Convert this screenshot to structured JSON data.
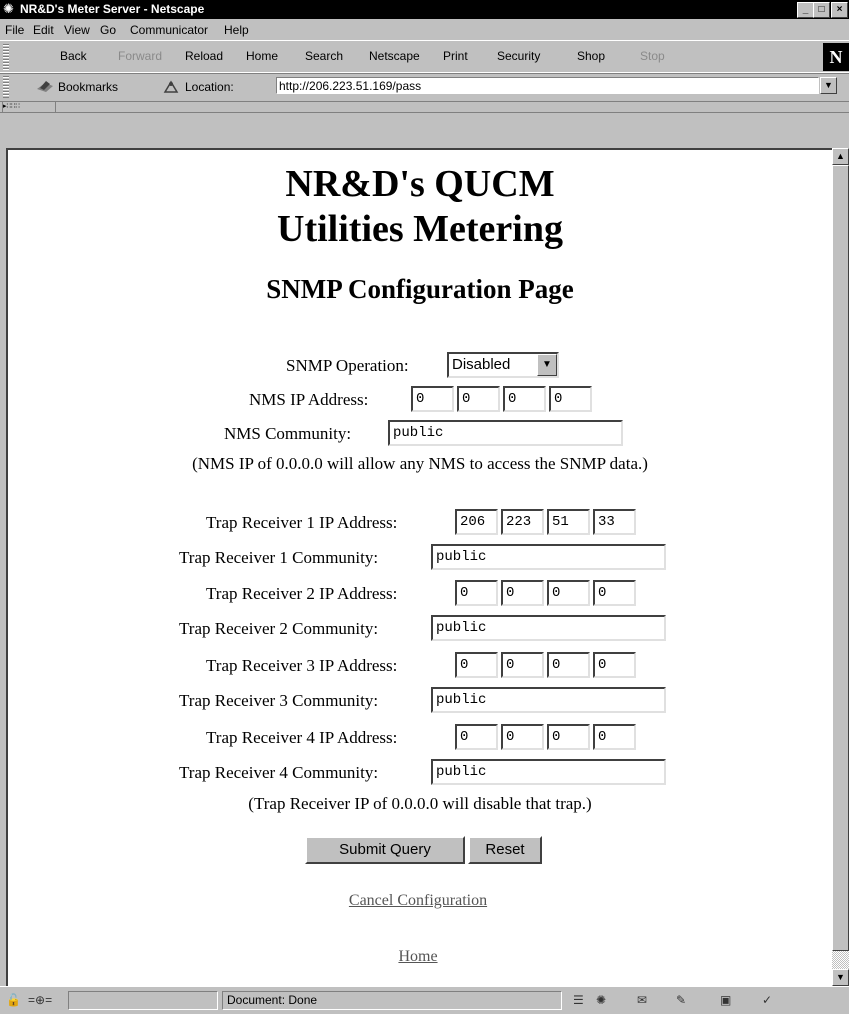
{
  "window": {
    "title": "NR&D's Meter Server - Netscape"
  },
  "menu": [
    "File",
    "Edit",
    "View",
    "Go",
    "Communicator",
    "Help"
  ],
  "toolbar": {
    "back": "Back",
    "forward": "Forward",
    "reload": "Reload",
    "home": "Home",
    "search": "Search",
    "netscape": "Netscape",
    "print": "Print",
    "security": "Security",
    "shop": "Shop",
    "stop": "Stop"
  },
  "location": {
    "bookmarks": "Bookmarks",
    "label": "Location:",
    "url": "http://206.223.51.169/pass"
  },
  "page": {
    "title_line1": "NR&D's QUCM",
    "title_line2": "Utilities Metering",
    "subtitle": "SNMP Configuration Page",
    "snmp_operation_label": "SNMP Operation:",
    "snmp_operation_value": "Disabled",
    "nms_ip_label": "NMS IP Address:",
    "nms_ip": [
      "0",
      "0",
      "0",
      "0"
    ],
    "nms_community_label": "NMS Community:",
    "nms_community": "public",
    "nms_note": "(NMS IP of 0.0.0.0 will allow any NMS to access the SNMP data.)",
    "traps": [
      {
        "ip_label": "Trap Receiver 1 IP Address:",
        "ip": [
          "206",
          "223",
          "51",
          "33"
        ],
        "community_label": "Trap Receiver 1 Community:",
        "community": "public"
      },
      {
        "ip_label": "Trap Receiver 2 IP Address:",
        "ip": [
          "0",
          "0",
          "0",
          "0"
        ],
        "community_label": "Trap Receiver 2 Community:",
        "community": "public"
      },
      {
        "ip_label": "Trap Receiver 3 IP Address:",
        "ip": [
          "0",
          "0",
          "0",
          "0"
        ],
        "community_label": "Trap Receiver 3 Community:",
        "community": "public"
      },
      {
        "ip_label": "Trap Receiver 4 IP Address:",
        "ip": [
          "0",
          "0",
          "0",
          "0"
        ],
        "community_label": "Trap Receiver 4 Community:",
        "community": "public"
      }
    ],
    "trap_note": "(Trap Receiver IP of 0.0.0.0 will disable that trap.)",
    "submit_label": "Submit Query",
    "reset_label": "Reset",
    "cancel_link": "Cancel Configuration",
    "home_link": "Home"
  },
  "status": {
    "text": "Document: Done"
  }
}
